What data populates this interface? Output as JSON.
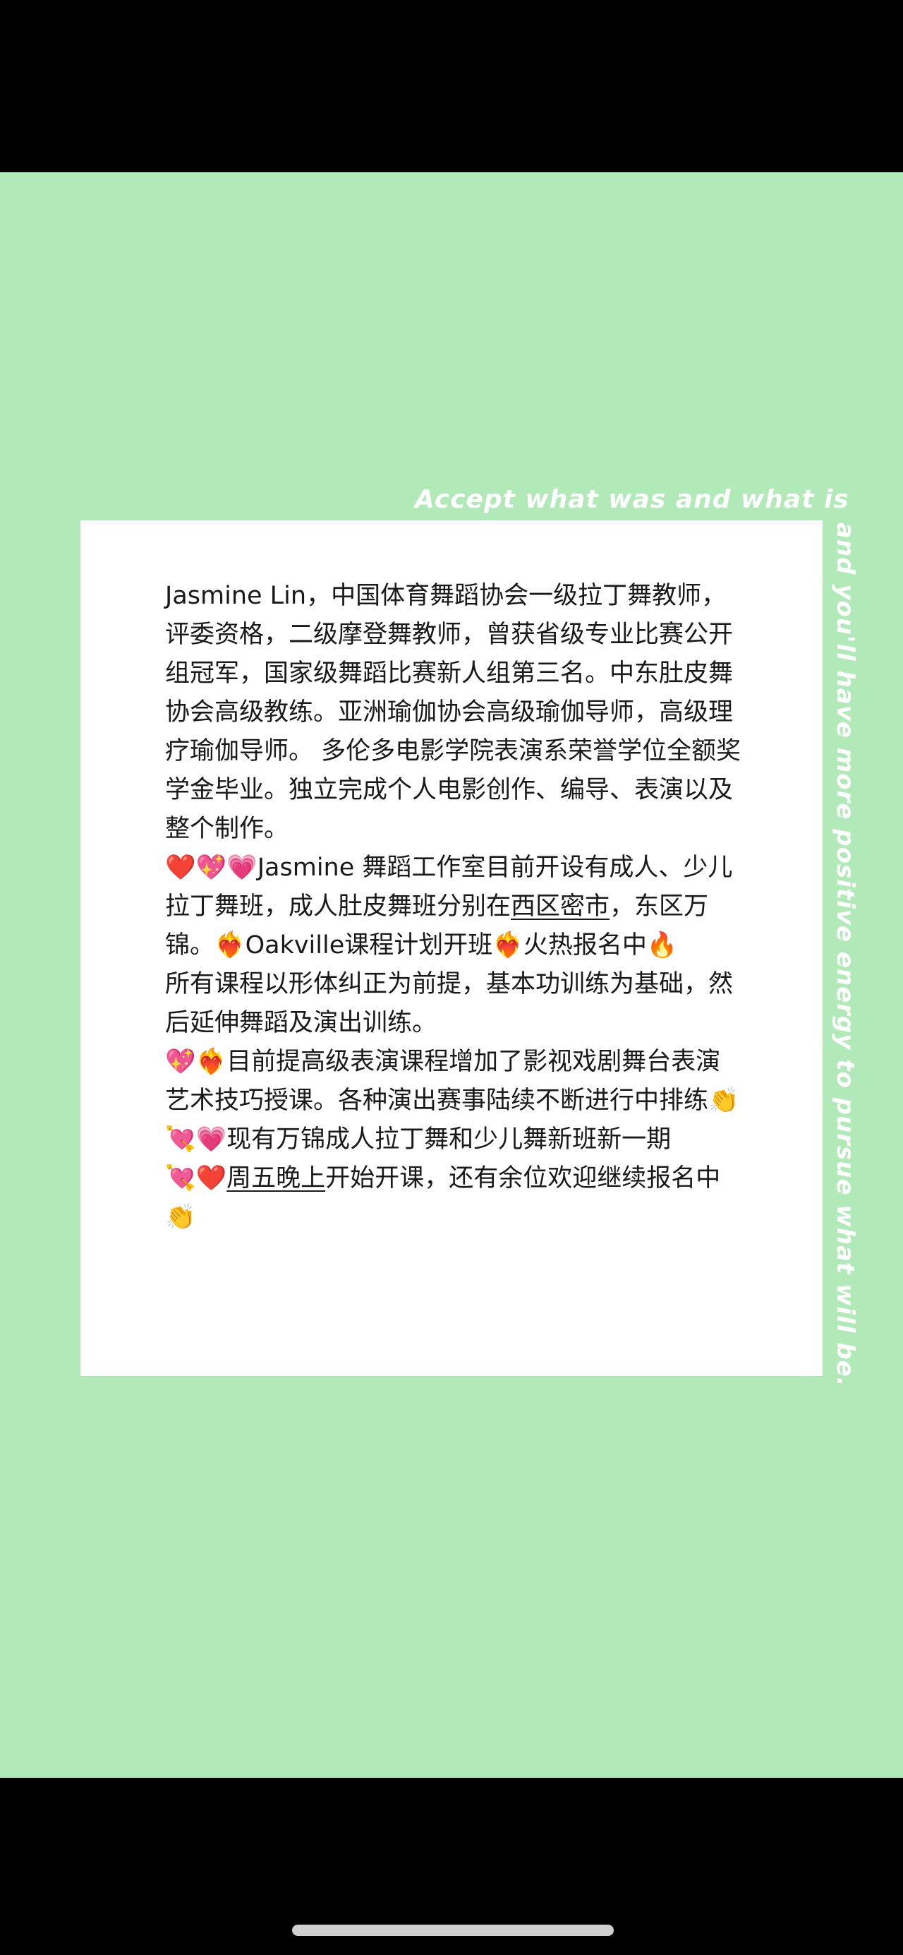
{
  "quote": {
    "top": "Accept what was and what is",
    "side": "and you'll have more positive energy to pursue what will be."
  },
  "card": {
    "p1": "Jasmine Lin，中国体育舞蹈协会一级拉丁舞教师，评委资格，二级摩登舞教师，曾获省级专业比赛公开组冠军，国家级舞蹈比赛新人组第三名。中东肚皮舞协会高级教练。亚洲瑜伽协会高级瑜伽导师，高级理疗瑜伽导师。 多伦多电影学院表演系荣誉学位全额奖学金毕业。独立完成个人电影创作、编导、表演以及整个制作。",
    "p2_a": "❤️💖💗Jasmine 舞蹈工作室目前开设有成人、少儿拉丁舞班，成人肚皮舞班分别在",
    "p2_link": "西区密市",
    "p2_b": "，东区万锦。❤️‍🔥Oakville课程计划开班❤️‍🔥火热报名中🔥",
    "p3": "所有课程以形体纠正为前提，基本功训练为基础，然后延伸舞蹈及演出训练。",
    "p4": "💖❤️‍🔥目前提高级表演课程增加了影视戏剧舞台表演艺术技巧授课。各种演出赛事陆续不断进行中排练👏",
    "p5": "💘💗现有万锦成人拉丁舞和少儿舞新班新一期",
    "p6_a": "💘❤️",
    "p6_link": "周五晚上",
    "p6_b": "开始开课，还有余位欢迎继续报名中👏"
  },
  "colors": {
    "background_green": "#b2e9b9",
    "card_white": "#ffffff",
    "text_dark": "#1a1a1a"
  }
}
